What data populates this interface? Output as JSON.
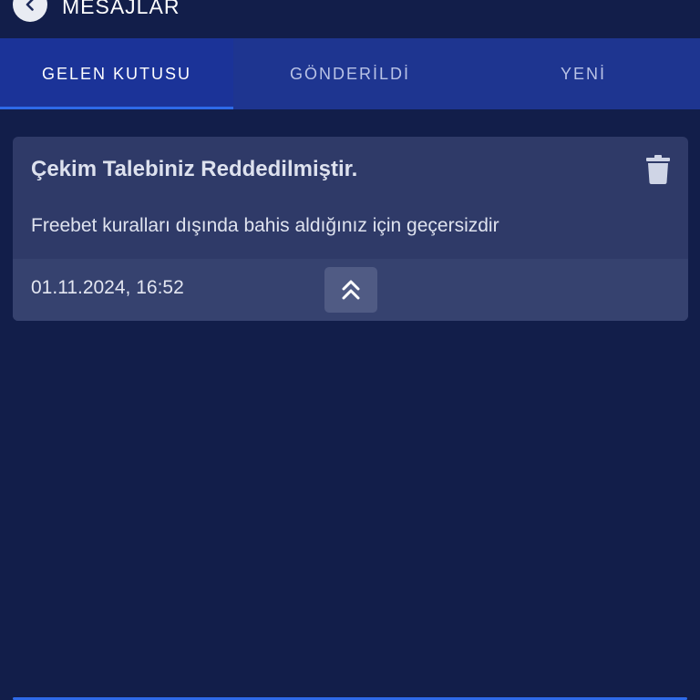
{
  "header": {
    "title": "MESAJLAR",
    "back_icon": "chevron-left-icon"
  },
  "tabs": [
    {
      "label": "GELEN KUTUSU",
      "active": true
    },
    {
      "label": "GÖNDERİLDİ",
      "active": false
    },
    {
      "label": "YENİ",
      "active": false
    }
  ],
  "messages": [
    {
      "title": "Çekim Talebiniz Reddedilmiştir.",
      "body": "Freebet kuralları dışında bahis aldığınız için geçersizdir",
      "date": "01.11.2024, 16:52",
      "delete_icon": "trash-icon",
      "collapse_icon": "chevron-double-up-icon"
    }
  ],
  "colors": {
    "background": "#121e4a",
    "tab_bar": "#1e3590",
    "active_indicator": "#2e6ae8",
    "card": "#2f3a68"
  }
}
